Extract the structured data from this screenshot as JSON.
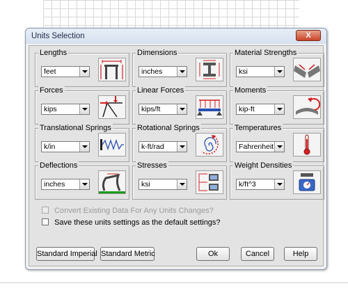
{
  "window": {
    "title": "Units Selection",
    "close_glyph": "X"
  },
  "groups": [
    {
      "label": "Lengths",
      "value": "feet",
      "icon": "frame-lengths-icon"
    },
    {
      "label": "Dimensions",
      "value": "inches",
      "icon": "ibeam-dimensions-icon"
    },
    {
      "label": "Material Strengths",
      "value": "ksi",
      "icon": "material-strength-icon"
    },
    {
      "label": "Forces",
      "value": "kips",
      "icon": "force-arrows-icon"
    },
    {
      "label": "Linear Forces",
      "value": "kips/ft",
      "icon": "distributed-load-icon"
    },
    {
      "label": "Moments",
      "value": "kip-ft",
      "icon": "moment-icon"
    },
    {
      "label": "Translational Springs",
      "value": "k/in",
      "icon": "translational-spring-icon"
    },
    {
      "label": "Rotational Springs",
      "value": "k-ft/rad",
      "icon": "rotational-spring-icon"
    },
    {
      "label": "Temperatures",
      "value": "Fahrenheit",
      "icon": "thermometer-icon"
    },
    {
      "label": "Deflections",
      "value": "inches",
      "icon": "deflection-icon"
    },
    {
      "label": "Stresses",
      "value": "ksi",
      "icon": "stress-icon"
    },
    {
      "label": "Weight Densities",
      "value": "k/ft^3",
      "icon": "scale-icon"
    }
  ],
  "checkboxes": {
    "convert": {
      "label": "Convert Existing Data For Any Units Changes?",
      "checked": false,
      "enabled": false
    },
    "save_default": {
      "label": "Save these units settings as the default settings?",
      "checked": false,
      "enabled": true
    }
  },
  "buttons": {
    "standard_imperial": "Standard Imperial",
    "standard_metric": "Standard Metric",
    "ok": "Ok",
    "cancel": "Cancel",
    "help": "Help"
  },
  "colors": {
    "accent_red": "#d42020",
    "ground_green": "#1a9a1a",
    "blue": "#2a4fb0"
  }
}
